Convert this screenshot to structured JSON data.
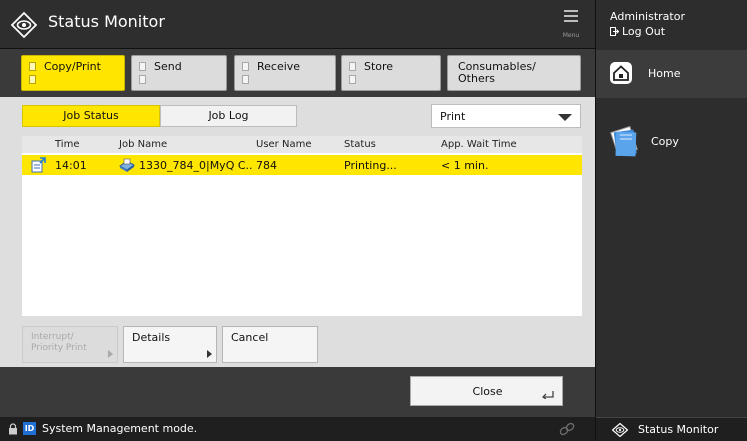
{
  "titlebar": {
    "title": "Status Monitor",
    "menu_label": "Menu"
  },
  "tabs": [
    {
      "label": "Copy/Print",
      "active": true
    },
    {
      "label": "Send",
      "active": false
    },
    {
      "label": "Receive",
      "active": false
    },
    {
      "label": "Store",
      "active": false
    },
    {
      "label": "Consumables/\nOthers",
      "active": false
    }
  ],
  "subtabs": {
    "job_status": "Job Status",
    "job_log": "Job Log"
  },
  "filter": {
    "selected": "Print"
  },
  "table": {
    "headers": [
      "Time",
      "Job Name",
      "User Name",
      "Status",
      "App. Wait Time"
    ],
    "rows": [
      {
        "time": "14:01",
        "job_name": "1330_784_0|MyQ C..",
        "user_name": "784",
        "status": "Printing...",
        "wait": "< 1 min."
      }
    ]
  },
  "actions": {
    "interrupt": "Interrupt/\nPriority Print",
    "details": "Details",
    "cancel": "Cancel"
  },
  "close_label": "Close",
  "statusbar": {
    "id_badge": "ID",
    "message": "System Management mode."
  },
  "sidebar": {
    "user": "Administrator",
    "logout": "Log Out",
    "home": "Home",
    "apps": [
      "Copy"
    ],
    "status_monitor": "Status Monitor"
  },
  "colors": {
    "accent_yellow": "#ffe600",
    "id_blue": "#1f6fd4"
  },
  "icons": {
    "title": "status-monitor-icon",
    "menu": "menu-icon",
    "home": "home-icon",
    "copy": "copy-icon",
    "logout": "logout-icon",
    "lock": "lock-icon",
    "link": "link-icon"
  }
}
